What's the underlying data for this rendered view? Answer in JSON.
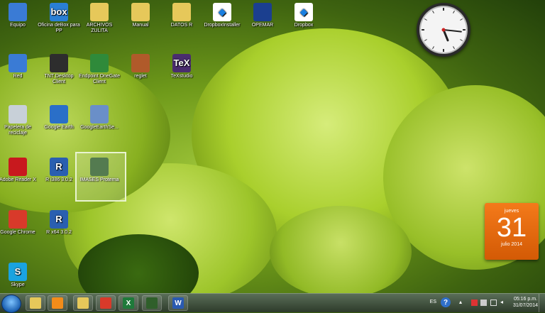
{
  "desktop_icons": [
    {
      "label": "Equipo",
      "icon": "computer-icon",
      "color": "#3a7bd5"
    },
    {
      "label": "Oficina deBox para PP",
      "icon": "box-icon",
      "color": "#2a7fd4",
      "glyph": "box"
    },
    {
      "label": "ARCHIVOS ZULITA",
      "icon": "folder-icon",
      "color": "#e6c85a"
    },
    {
      "label": "Manual",
      "icon": "folder-icon",
      "color": "#e6c85a"
    },
    {
      "label": "DATOS R",
      "icon": "folder-icon",
      "color": "#e6c85a"
    },
    {
      "label": "DropboxInstaller",
      "icon": "dropbox-icon",
      "color": "#ffffff"
    },
    {
      "label": "OPEMAR",
      "icon": "opemar-icon",
      "color": "#1b3f8f"
    },
    {
      "label": "Dropbox",
      "icon": "dropbox-icon",
      "color": "#ffffff"
    },
    {
      "label": "Red",
      "icon": "network-icon",
      "color": "#3a7bd5"
    },
    {
      "label": "TNT Desktop Client",
      "icon": "tnt-icon",
      "color": "#2d2d2d"
    },
    {
      "label": "Endpoint OneGate Client",
      "icon": "shield-icon",
      "color": "#2f8a3a"
    },
    {
      "label": "reglet",
      "icon": "image-icon",
      "color": "#b05a2a"
    },
    {
      "label": "TeXstudio",
      "icon": "texstudio-icon",
      "color": "#4a2d6e",
      "glyph": "TeX"
    },
    {
      "label": "Papelera de reciclaje",
      "icon": "recycle-bin-icon",
      "color": "#c8d0d8"
    },
    {
      "label": "Google Earth",
      "icon": "google-earth-icon",
      "color": "#2a6fc8"
    },
    {
      "label": "GoogleEarthSe...",
      "icon": "google-earth-setup-icon",
      "color": "#6a8fc8"
    },
    {
      "label": "Adobe Reader X",
      "icon": "adobe-reader-icon",
      "color": "#c8191e"
    },
    {
      "label": "R i386 3.0.2",
      "icon": "r-icon",
      "color": "#2a5fb0",
      "glyph": "R"
    },
    {
      "label": "IMASES Protema",
      "icon": "imases-icon",
      "color": "#2f5f2a"
    },
    {
      "label": "Google Chrome",
      "icon": "chrome-icon",
      "color": "#d83a2a"
    },
    {
      "label": "R x64 3.0.2",
      "icon": "r-icon",
      "color": "#2a5fb0",
      "glyph": "R"
    },
    {
      "label": "Skype",
      "icon": "skype-icon",
      "color": "#1aa3e0",
      "glyph": "S"
    }
  ],
  "calendar": {
    "weekday": "jueves",
    "day": "31",
    "month_year": "julio 2014"
  },
  "clock_gadget": {
    "time": "5:16"
  },
  "taskbar": {
    "pinned": [
      {
        "name": "explorer-icon",
        "color": "#e6c85a"
      },
      {
        "name": "media-player-icon",
        "color": "#f28c1a"
      },
      {
        "name": "folder-icon",
        "color": "#e6c85a"
      },
      {
        "name": "chrome-icon",
        "color": "#d83a2a"
      },
      {
        "name": "excel-icon",
        "color": "#1f7a3a",
        "glyph": "X"
      },
      {
        "name": "imases-icon",
        "color": "#2f5f2a"
      },
      {
        "name": "word-icon",
        "color": "#2a5ab0",
        "glyph": "W"
      }
    ],
    "language": "ES",
    "time": "05:16 p.m.",
    "date": "31/07/2014"
  }
}
